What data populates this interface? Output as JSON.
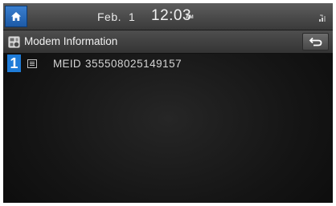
{
  "status_bar": {
    "date": "Feb.",
    "day": "1",
    "time": "12:03",
    "ampm": "AM",
    "home_icon": "home-icon",
    "signal_icon": "signal-strength-icon"
  },
  "title_bar": {
    "title": "Modem Information",
    "title_icon": "modem-info-icon",
    "back_icon": "back-arrow-icon"
  },
  "list": {
    "items": [
      {
        "number": "1",
        "icon": "list-item-icon",
        "key": "MEID",
        "value": "355508025149157"
      }
    ]
  },
  "colors": {
    "accent_blue": "#1f7cd8",
    "background": "#151515",
    "text": "#d4d4d4"
  }
}
